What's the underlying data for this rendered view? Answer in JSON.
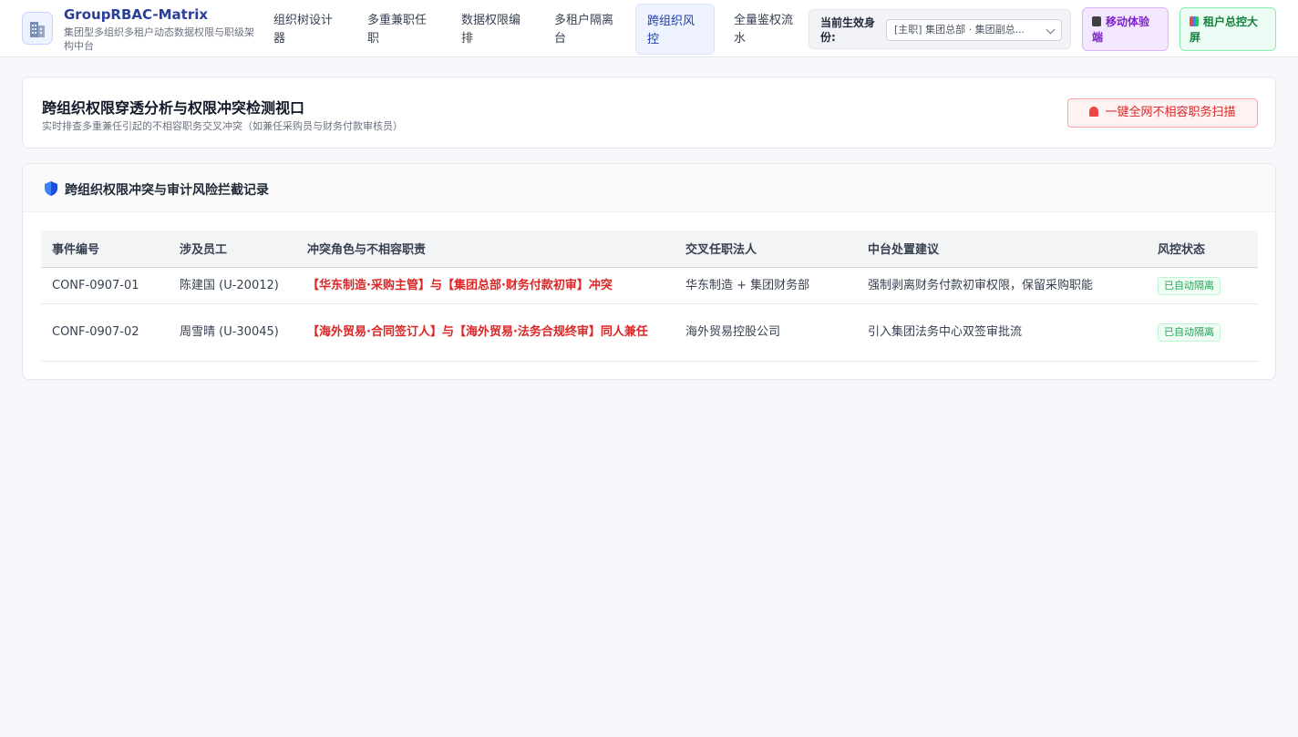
{
  "app": {
    "title": "GroupRBAC-Matrix",
    "subtitle": "集团型多组织多租户动态数据权限与职级架构中台"
  },
  "nav": {
    "items": [
      {
        "label": "组织树设计器",
        "active": false
      },
      {
        "label": "多重兼职任职",
        "active": false
      },
      {
        "label": "数据权限编排",
        "active": false
      },
      {
        "label": "多租户隔离台",
        "active": false
      },
      {
        "label": "跨组织风控",
        "active": true
      },
      {
        "label": "全量鉴权流水",
        "active": false
      }
    ]
  },
  "identity": {
    "label": "当前生效身份:",
    "value": "[主职] 集团总部 · 集团副总..."
  },
  "actions": {
    "mobile_label": "移动体验端",
    "screen_label": "租户总控大屏"
  },
  "header_card": {
    "title": "跨组织权限穿透分析与权限冲突检测视口",
    "subtitle": "实时排查多重兼任引起的不相容职务交叉冲突（如兼任采购员与财务付款审核员）",
    "scan_button": "一键全网不相容职务扫描"
  },
  "records": {
    "title": "跨组织权限冲突与审计风险拦截记录",
    "columns": [
      "事件编号",
      "涉及员工",
      "冲突角色与不相容职责",
      "交叉任职法人",
      "中台处置建议",
      "风控状态"
    ],
    "rows": [
      {
        "id": "CONF-0907-01",
        "employee": "陈建国 (U-20012)",
        "conflict": "【华东制造·采购主管】与【集团总部·财务付款初审】冲突",
        "entity": "华东制造 + 集团财务部",
        "suggestion": "强制剥离财务付款初审权限，保留采购职能",
        "status": "已自动隔离"
      },
      {
        "id": "CONF-0907-02",
        "employee": "周雪晴 (U-30045)",
        "conflict": "【海外贸易·合同签订人】与【海外贸易·法务合规终审】同人兼任",
        "entity": "海外贸易控股公司",
        "suggestion": "引入集团法务中心双签审批流",
        "status": "已自动隔离"
      }
    ]
  },
  "colors": {
    "brand": "#2a3e9c",
    "danger": "#dc2626",
    "success": "#22a355"
  }
}
